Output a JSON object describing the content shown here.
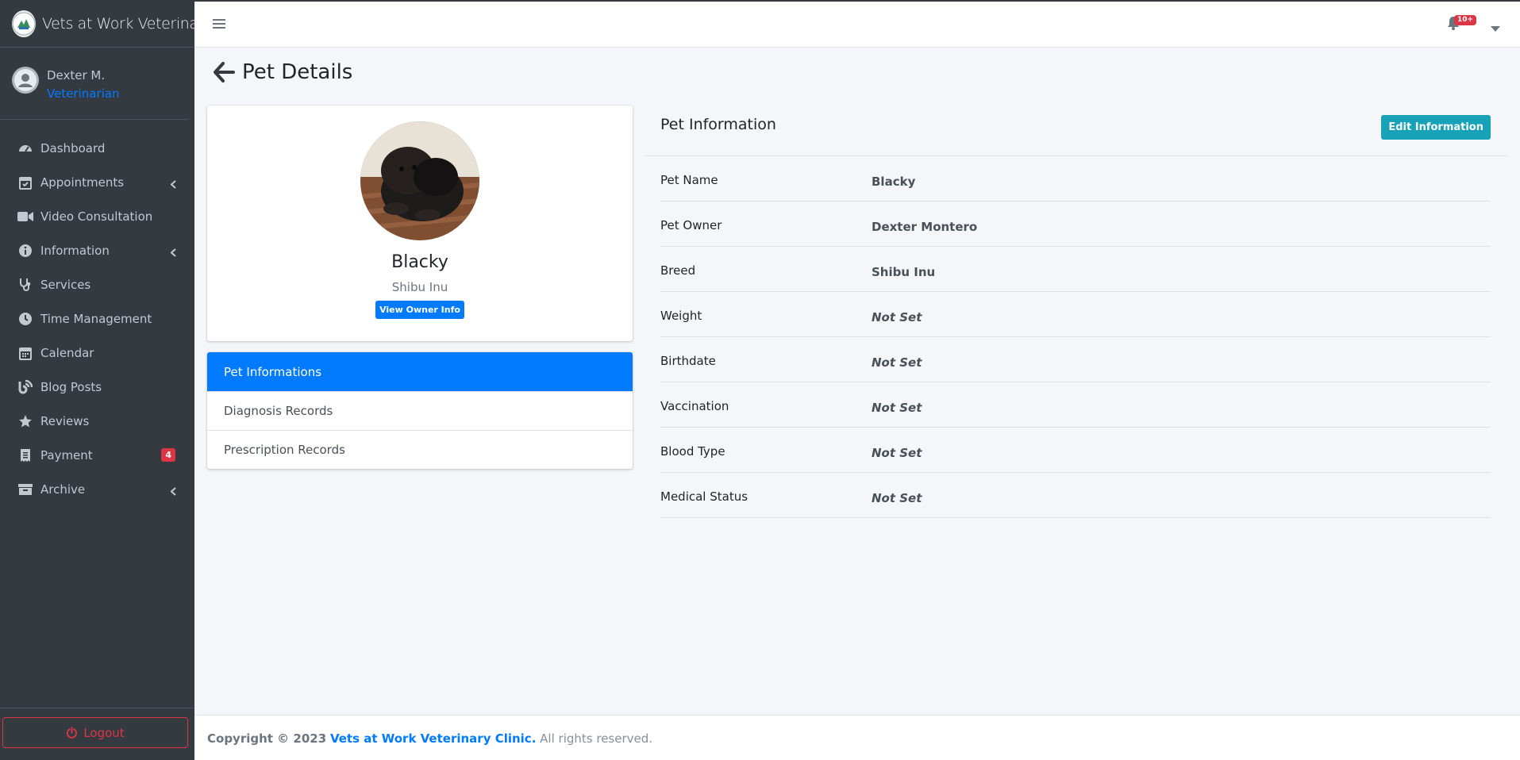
{
  "brand": {
    "name": "Vets at Work Veterinary"
  },
  "user": {
    "name": "Dexter M.",
    "role": "Veterinarian"
  },
  "sidebar": {
    "items": [
      {
        "label": "Dashboard",
        "icon": "dashboard-icon"
      },
      {
        "label": "Appointments",
        "icon": "calendar-check-icon",
        "has_submenu": true
      },
      {
        "label": "Video Consultation",
        "icon": "video-icon"
      },
      {
        "label": "Information",
        "icon": "info-icon",
        "has_submenu": true
      },
      {
        "label": "Services",
        "icon": "stethoscope-icon"
      },
      {
        "label": "Time Management",
        "icon": "clock-icon"
      },
      {
        "label": "Calendar",
        "icon": "calendar-icon"
      },
      {
        "label": "Blog Posts",
        "icon": "blog-icon"
      },
      {
        "label": "Reviews",
        "icon": "star-icon"
      },
      {
        "label": "Payment",
        "icon": "receipt-icon",
        "badge": "4"
      },
      {
        "label": "Archive",
        "icon": "archive-icon",
        "has_submenu": true
      }
    ],
    "logout_label": "Logout"
  },
  "header": {
    "notification_count": "10+"
  },
  "page": {
    "title": "Pet Details"
  },
  "profile": {
    "name": "Blacky",
    "breed": "Shibu Inu",
    "owner_button": "View Owner Info"
  },
  "tabs": [
    {
      "label": "Pet Informations",
      "active": true
    },
    {
      "label": "Diagnosis Records",
      "active": false
    },
    {
      "label": "Prescription Records",
      "active": false
    }
  ],
  "info": {
    "title": "Pet Information",
    "edit_button": "Edit Information",
    "rows": [
      {
        "label": "Pet Name",
        "value": "Blacky",
        "unset": false
      },
      {
        "label": "Pet Owner",
        "value": "Dexter Montero",
        "unset": false
      },
      {
        "label": "Breed",
        "value": "Shibu Inu",
        "unset": false
      },
      {
        "label": "Weight",
        "value": "Not Set",
        "unset": true
      },
      {
        "label": "Birthdate",
        "value": "Not Set",
        "unset": true
      },
      {
        "label": "Vaccination",
        "value": "Not Set",
        "unset": true
      },
      {
        "label": "Blood Type",
        "value": "Not Set",
        "unset": true
      },
      {
        "label": "Medical Status",
        "value": "Not Set",
        "unset": true
      }
    ]
  },
  "footer": {
    "prefix": "Copyright © 2023",
    "clinic": "Vets at Work Veterinary Clinic.",
    "suffix": "All rights reserved."
  },
  "colors": {
    "sidebar": "#343a40",
    "primary": "#007bff",
    "info": "#17a2b8",
    "danger": "#dc3545"
  }
}
